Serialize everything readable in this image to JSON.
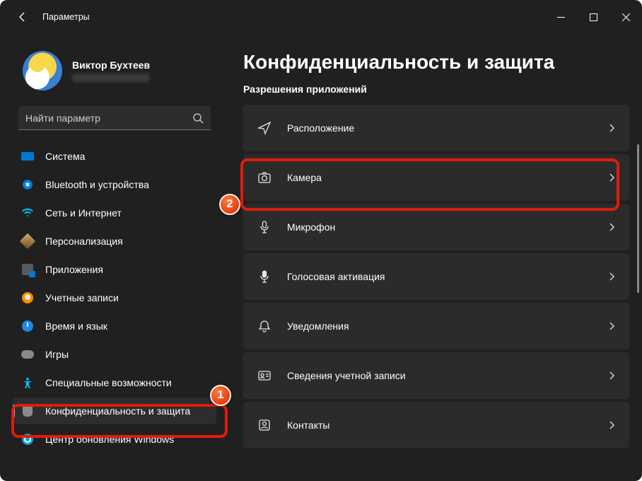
{
  "window": {
    "title": "Параметры"
  },
  "profile": {
    "name": "Виктор Бухтеев"
  },
  "search": {
    "placeholder": "Найти параметр"
  },
  "sidebar": {
    "items": [
      {
        "label": "Система"
      },
      {
        "label": "Bluetooth и устройства"
      },
      {
        "label": "Сеть и Интернет"
      },
      {
        "label": "Персонализация"
      },
      {
        "label": "Приложения"
      },
      {
        "label": "Учетные записи"
      },
      {
        "label": "Время и язык"
      },
      {
        "label": "Игры"
      },
      {
        "label": "Специальные возможности"
      },
      {
        "label": "Конфиденциальность и защита",
        "selected": true
      },
      {
        "label": "Центр обновления Windows"
      }
    ]
  },
  "page": {
    "title": "Конфиденциальность и защита",
    "section": "Разрешения приложений",
    "cards": [
      {
        "name": "location",
        "label": "Расположение"
      },
      {
        "name": "camera",
        "label": "Камера"
      },
      {
        "name": "microphone",
        "label": "Микрофон"
      },
      {
        "name": "voice",
        "label": "Голосовая активация"
      },
      {
        "name": "notifications",
        "label": "Уведомления"
      },
      {
        "name": "account-info",
        "label": "Сведения учетной записи"
      },
      {
        "name": "contacts",
        "label": "Контакты"
      }
    ]
  },
  "annotations": {
    "badge1": "1",
    "badge2": "2"
  }
}
